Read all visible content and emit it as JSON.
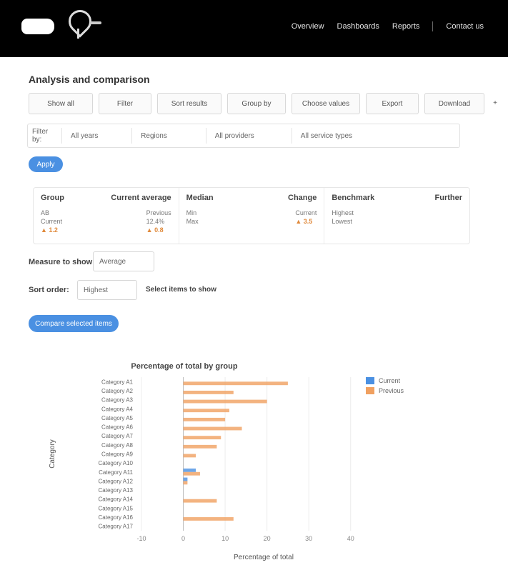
{
  "header": {
    "nav": [
      "Overview",
      "Dashboards",
      "Reports",
      "Contact us"
    ]
  },
  "main": {
    "section_title": "Analysis and comparison",
    "toolbar": [
      "Show all",
      "Filter",
      "Sort results",
      "Group by",
      "Choose values",
      "Export",
      "Download",
      "+"
    ],
    "filters": {
      "label": "Filter by:",
      "boxes": [
        "All years",
        "Regions",
        "All providers",
        "All service types"
      ]
    },
    "apply_label": "Apply",
    "cards": [
      {
        "head_left": "Group",
        "head_right": "Current average",
        "left": [
          "AB",
          "Current",
          "▲ 1.2"
        ],
        "right": [
          "Previous",
          "12.4%",
          "▲ 0.8"
        ]
      },
      {
        "head_left": "Median",
        "head_right": "Change",
        "left": [
          "Min",
          "Max"
        ],
        "right": [
          "Current",
          "▲ 3.5"
        ]
      },
      {
        "head_left": "Benchmark",
        "head_right": "Further",
        "left": [
          "Highest",
          "Lowest"
        ],
        "right": []
      }
    ],
    "measure_label": "Measure to show:",
    "measure_value": "Average",
    "sort_label": "Sort order:",
    "sort_value": "Highest",
    "show_label": "Select items to show",
    "run_label": "Compare selected items",
    "chart_title": "Percentage of total by group"
  },
  "chart_data": {
    "type": "bar",
    "title": "Percentage of total by group",
    "xlabel": "Percentage of total",
    "ylabel": "Category",
    "xlim": [
      -10,
      45
    ],
    "xticks": [
      -10,
      0,
      10,
      20,
      30,
      40
    ],
    "categories": [
      "Category A1",
      "Category A2",
      "Category A3",
      "Category A4",
      "Category A5",
      "Category A6",
      "Category A7",
      "Category A8",
      "Category A9",
      "Category A10",
      "Category A11",
      "Category A12",
      "Category A13",
      "Category A14",
      "Category A15",
      "Category A16",
      "Category A17"
    ],
    "series": [
      {
        "name": "Current",
        "color": "#4a90e2",
        "values": [
          0,
          0,
          0,
          0,
          0,
          0,
          0,
          0,
          0,
          0,
          3,
          1,
          0,
          0,
          0,
          0,
          0
        ]
      },
      {
        "name": "Previous",
        "color": "#f0a060",
        "values": [
          25,
          12,
          20,
          11,
          10,
          14,
          9,
          8,
          3,
          0,
          4,
          1,
          0,
          8,
          0,
          12,
          0
        ]
      }
    ],
    "legend": "top-right",
    "grid": true
  }
}
